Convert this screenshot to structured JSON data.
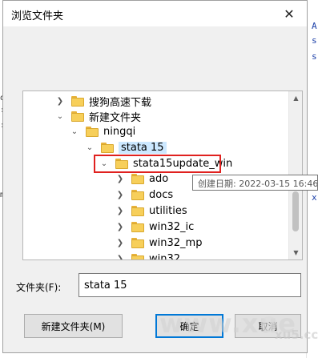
{
  "dialog": {
    "title": "浏览文件夹",
    "close_glyph": "✕"
  },
  "tree": {
    "items": [
      {
        "label": "搜狗高速下载",
        "expanded": false
      },
      {
        "label": "新建文件夹",
        "expanded": true
      },
      {
        "label": "ningqi",
        "expanded": true
      },
      {
        "label": "stata 15",
        "expanded": true
      },
      {
        "label": "stata15update_win",
        "expanded": true,
        "selected": true
      },
      {
        "label": "ado",
        "expanded": false
      },
      {
        "label": "docs",
        "expanded": false
      },
      {
        "label": "utilities",
        "expanded": false
      },
      {
        "label": "win32_ic",
        "expanded": false
      },
      {
        "label": "win32_mp",
        "expanded": false
      },
      {
        "label": "win32_...",
        "expanded": false
      }
    ]
  },
  "tooltip": {
    "text": "创建日期: 2022-03-15 16:46"
  },
  "folder_field": {
    "label": "文件夹(F):",
    "value": "stata 15"
  },
  "buttons": {
    "new_folder": "新建文件夹(M)",
    "ok": "确定",
    "cancel": "取消"
  },
  "watermark": {
    "main": "www.xue",
    "sub": "xu5.cc"
  },
  "colors": {
    "selection": "#cce8ff",
    "highlight_outline": "#e0211f",
    "focus_border": "#0078d7",
    "folder": "#f7cf5a"
  },
  "background_text": {
    "right_chars": [
      "A",
      "s",
      "s",
      "x"
    ],
    "left_chars": [
      "o",
      ":",
      ":",
      "m"
    ]
  }
}
